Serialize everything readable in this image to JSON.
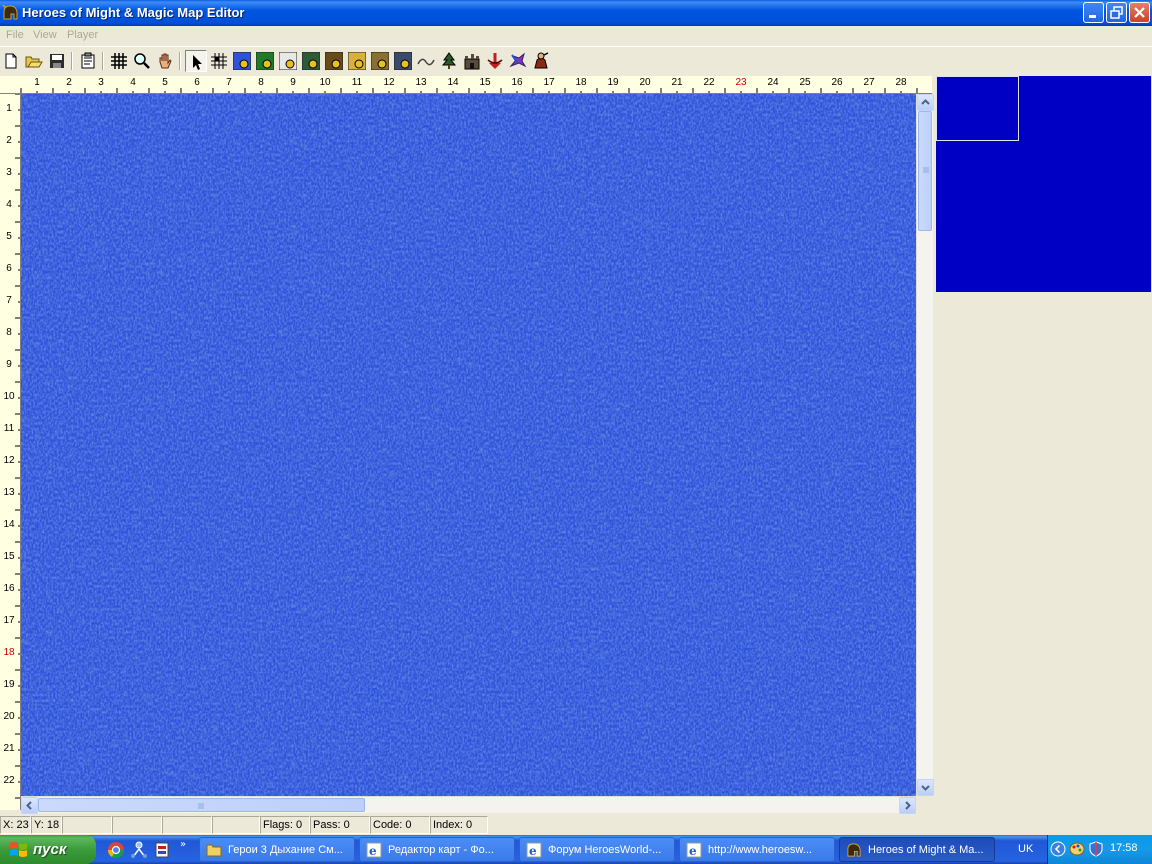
{
  "window": {
    "title": "Heroes of Might & Magic Map Editor",
    "app_icon": "helmet-icon",
    "controls": [
      "minimize-icon",
      "restore-icon",
      "close-icon"
    ]
  },
  "menu": {
    "items": [
      {
        "label": "File"
      },
      {
        "label": "View"
      },
      {
        "label": "Player"
      }
    ]
  },
  "toolbar": {
    "buttons": [
      {
        "name": "new-file",
        "icon": "new-file-icon"
      },
      {
        "name": "open-file",
        "icon": "open-folder-icon"
      },
      {
        "name": "save-file",
        "icon": "save-icon"
      },
      {
        "name": "properties",
        "icon": "properties-icon"
      },
      {
        "name": "grid",
        "icon": "grid-icon"
      },
      {
        "name": "zoom",
        "icon": "magnifier-icon"
      },
      {
        "name": "scroll",
        "icon": "hand-icon"
      },
      {
        "name": "select",
        "icon": "arrow-cursor-icon",
        "pressed": true
      },
      {
        "name": "passability-grid",
        "icon": "hatch-grid-icon"
      },
      {
        "name": "terrain-1",
        "icon": "terrain-water-icon"
      },
      {
        "name": "terrain-2",
        "icon": "terrain-grass-icon"
      },
      {
        "name": "terrain-3",
        "icon": "terrain-snow-icon"
      },
      {
        "name": "terrain-4",
        "icon": "terrain-swamp-icon"
      },
      {
        "name": "terrain-5",
        "icon": "terrain-dirt-icon"
      },
      {
        "name": "terrain-6",
        "icon": "terrain-sand-icon"
      },
      {
        "name": "terrain-7",
        "icon": "terrain-rough-icon"
      },
      {
        "name": "terrain-8",
        "icon": "terrain-lava-icon"
      },
      {
        "name": "roads",
        "icon": "road-icon"
      },
      {
        "name": "trees",
        "icon": "tree-icon"
      },
      {
        "name": "towns",
        "icon": "castle-icon"
      },
      {
        "name": "artifacts",
        "icon": "artifact-icon"
      },
      {
        "name": "monsters",
        "icon": "dragon-icon"
      },
      {
        "name": "heroes",
        "icon": "hero-icon"
      }
    ]
  },
  "ruler": {
    "columns": [
      "1",
      "2",
      "3",
      "4",
      "5",
      "6",
      "7",
      "8",
      "9",
      "10",
      "11",
      "12",
      "13",
      "14",
      "15",
      "16",
      "17",
      "18",
      "19",
      "20",
      "21",
      "22",
      "23",
      "24",
      "25",
      "26",
      "27",
      "28"
    ],
    "rows": [
      "1",
      "2",
      "3",
      "4",
      "5",
      "6",
      "7",
      "8",
      "9",
      "10",
      "11",
      "12",
      "13",
      "14",
      "15",
      "16",
      "17",
      "18",
      "19",
      "20",
      "21",
      "22"
    ],
    "highlight_column": "23",
    "highlight_row": "18",
    "highlight_color": "#D00000"
  },
  "map": {
    "terrain_color": "#2E52D8",
    "vscroll_fraction": 0.18,
    "hscroll_fraction": 0.38
  },
  "minimap": {
    "color": "#0000C4"
  },
  "status": {
    "x": "X: 23",
    "y": "Y: 18",
    "flags": "Flags: 0",
    "pass": "Pass: 0",
    "code": "Code: 0",
    "index": "Index: 0"
  },
  "taskbar": {
    "start_label": "пуск",
    "quicklaunch": [
      "chrome-icon",
      "network-icon",
      "install-icon"
    ],
    "tasks": [
      {
        "label": "Герои 3 Дыхание См...",
        "icon": "folder-icon"
      },
      {
        "label": "Редактор карт - Фо...",
        "icon": "ie-icon"
      },
      {
        "label": "Форум HeroesWorld-...",
        "icon": "ie-icon"
      },
      {
        "label": "http://www.heroesw...",
        "icon": "ie-icon"
      },
      {
        "label": "Heroes of Might & Ma...",
        "icon": "helmet-icon",
        "active": true
      }
    ],
    "language": "UK",
    "clock": "17:58"
  }
}
